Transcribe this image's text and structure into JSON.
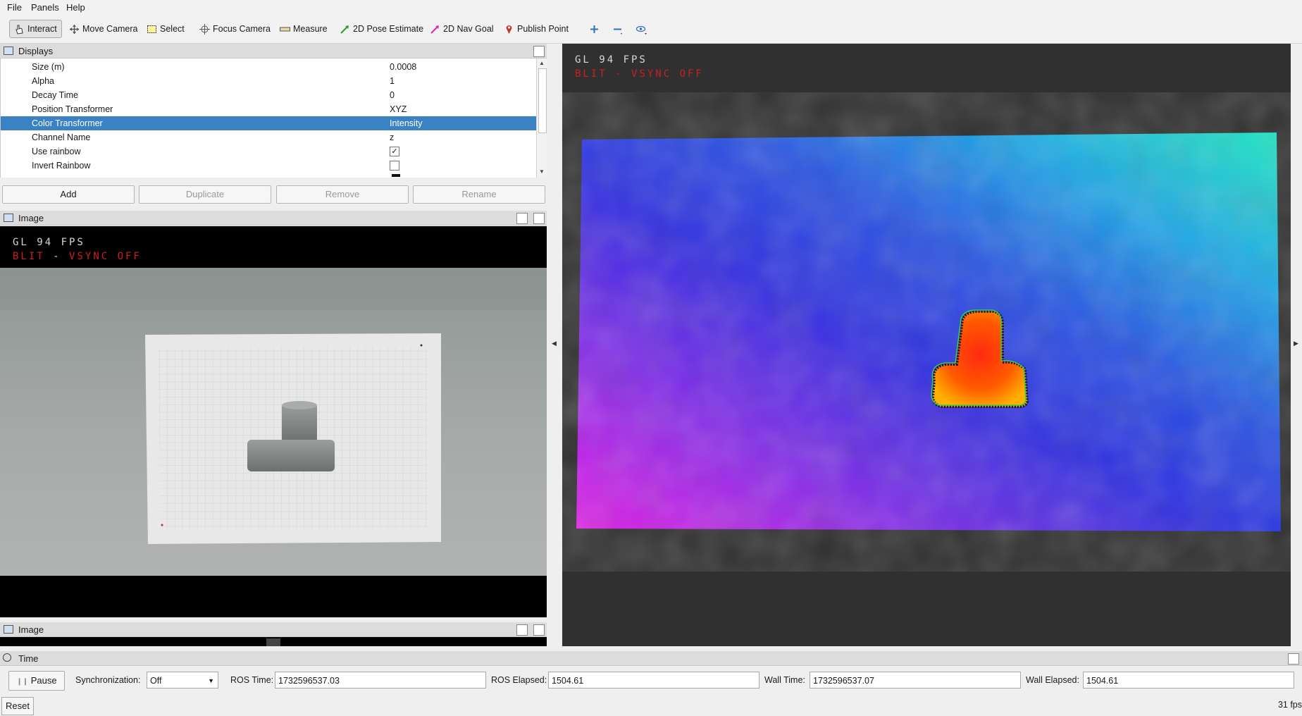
{
  "menubar": {
    "items": [
      "File",
      "Panels",
      "Help"
    ]
  },
  "toolbar": {
    "tools": [
      "Interact",
      "Move Camera",
      "Select",
      "Focus Camera",
      "Measure",
      "2D Pose Estimate",
      "2D Nav Goal",
      "Publish Point"
    ],
    "active": "Interact"
  },
  "displays": {
    "title": "Displays",
    "rows": [
      {
        "key": "Size (m)",
        "value": "0.0008"
      },
      {
        "key": "Alpha",
        "value": "1"
      },
      {
        "key": "Decay Time",
        "value": "0"
      },
      {
        "key": "Position Transformer",
        "value": "XYZ"
      },
      {
        "key": "Color Transformer",
        "value": "Intensity"
      },
      {
        "key": "Channel Name",
        "value": "z"
      },
      {
        "key": "Use rainbow",
        "value": "checked"
      },
      {
        "key": "Invert Rainbow",
        "value": "unchecked"
      }
    ],
    "selected_row": "Color Transformer",
    "buttons": {
      "add": "Add",
      "duplicate": "Duplicate",
      "remove": "Remove",
      "rename": "Rename"
    }
  },
  "image_panel_1": {
    "title": "Image",
    "osd_line1": "GL 94 FPS",
    "osd_line2_a": "BLIT",
    "osd_line2_sep": "-",
    "osd_line2_b": "VSYNC OFF"
  },
  "image_panel_2": {
    "title": "Image"
  },
  "viewport": {
    "osd_line1": "GL 94 FPS",
    "osd_line2": "BLIT - VSYNC OFF"
  },
  "time_panel": {
    "title": "Time",
    "pause_label": "Pause",
    "sync_label": "Synchronization:",
    "sync_value": "Off",
    "ros_time_label": "ROS Time:",
    "ros_time": "1732596537.03",
    "ros_elapsed_label": "ROS Elapsed:",
    "ros_elapsed": "1504.61",
    "wall_time_label": "Wall Time:",
    "wall_time": "1732596537.07",
    "wall_elapsed_label": "Wall Elapsed:",
    "wall_elapsed": "1504.61",
    "reset_label": "Reset",
    "fps": "31 fps"
  },
  "colors": {
    "selection": "#3a82c4",
    "osd_red": "#cc1f1f",
    "viewport_bg": "#303030"
  }
}
